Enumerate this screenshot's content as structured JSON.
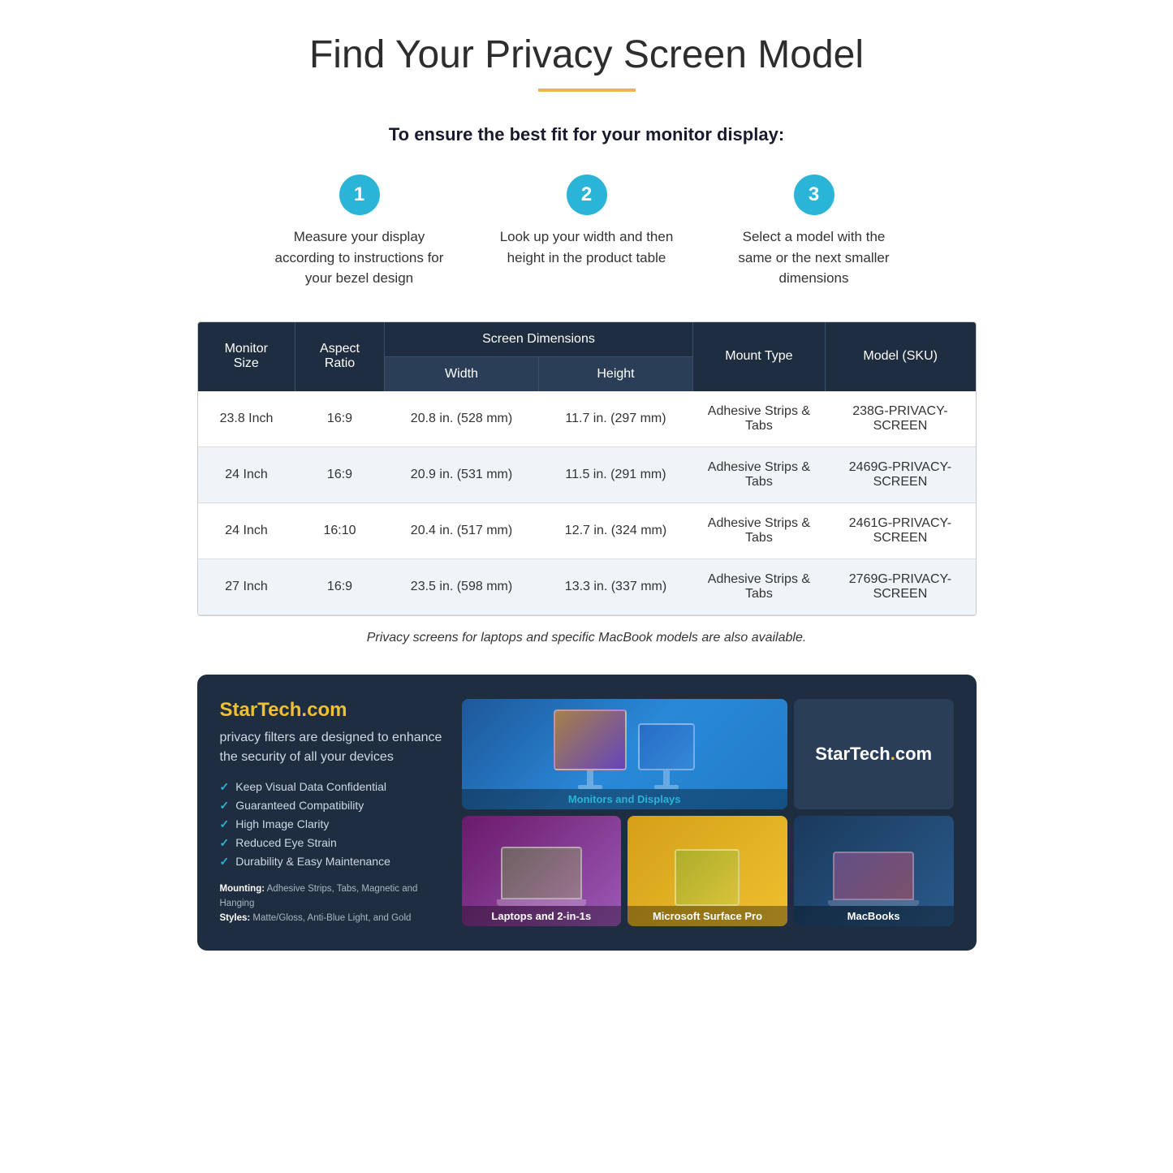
{
  "page": {
    "title": "Find Your Privacy Screen Model",
    "title_underline_color": "#e8b84b",
    "subtitle": "To ensure the best fit for your monitor display:"
  },
  "steps": [
    {
      "number": "1",
      "text": "Measure your display according to instructions for your bezel design"
    },
    {
      "number": "2",
      "text": "Look up your width and then height in the product table"
    },
    {
      "number": "3",
      "text": "Select a model with the same or the next smaller dimensions"
    }
  ],
  "table": {
    "header": {
      "monitor_size": "Monitor Size",
      "aspect_ratio": "Aspect Ratio",
      "screen_dimensions": "Screen Dimensions",
      "width": "Width",
      "height": "Height",
      "mount_type": "Mount Type",
      "model_sku": "Model (SKU)"
    },
    "rows": [
      {
        "monitor_size": "23.8 Inch",
        "aspect_ratio": "16:9",
        "width": "20.8 in. (528 mm)",
        "height": "11.7 in. (297 mm)",
        "mount_type": "Adhesive Strips & Tabs",
        "model_sku": "238G-PRIVACY-SCREEN"
      },
      {
        "monitor_size": "24 Inch",
        "aspect_ratio": "16:9",
        "width": "20.9 in. (531 mm)",
        "height": "11.5 in. (291 mm)",
        "mount_type": "Adhesive Strips & Tabs",
        "model_sku": "2469G-PRIVACY-SCREEN"
      },
      {
        "monitor_size": "24 Inch",
        "aspect_ratio": "16:10",
        "width": "20.4 in. (517 mm)",
        "height": "12.7 in. (324 mm)",
        "mount_type": "Adhesive Strips & Tabs",
        "model_sku": "2461G-PRIVACY-SCREEN"
      },
      {
        "monitor_size": "27 Inch",
        "aspect_ratio": "16:9",
        "width": "23.5 in. (598 mm)",
        "height": "13.3 in. (337 mm)",
        "mount_type": "Adhesive Strips & Tabs",
        "model_sku": "2769G-PRIVACY-SCREEN"
      }
    ]
  },
  "table_note": "Privacy screens for laptops and specific MacBook models are also available.",
  "banner": {
    "brand": "StarTech.com",
    "tagline": "privacy filters are designed  to enhance the security of all your devices",
    "features": [
      "Keep Visual Data Confidential",
      "Guaranteed Compatibility",
      "High Image Clarity",
      "Reduced Eye Strain",
      "Durability & Easy Maintenance"
    ],
    "mounting_label": "Mounting:",
    "mounting_text": "Adhesive Strips, Tabs, Magnetic and Hanging",
    "styles_label": "Styles:",
    "styles_text": "Matte/Gloss, Anti-Blue Light, and Gold",
    "cells": [
      {
        "id": "monitors",
        "label": "Monitors and Displays"
      },
      {
        "id": "laptops",
        "label": "Laptops and 2-in-1s"
      },
      {
        "id": "surface",
        "label": "Microsoft Surface Pro"
      },
      {
        "id": "macbooks",
        "label": "MacBooks"
      }
    ],
    "startech_logo": "StarTech",
    "startech_logo_dot": ".",
    "startech_logo_suffix": "com"
  }
}
